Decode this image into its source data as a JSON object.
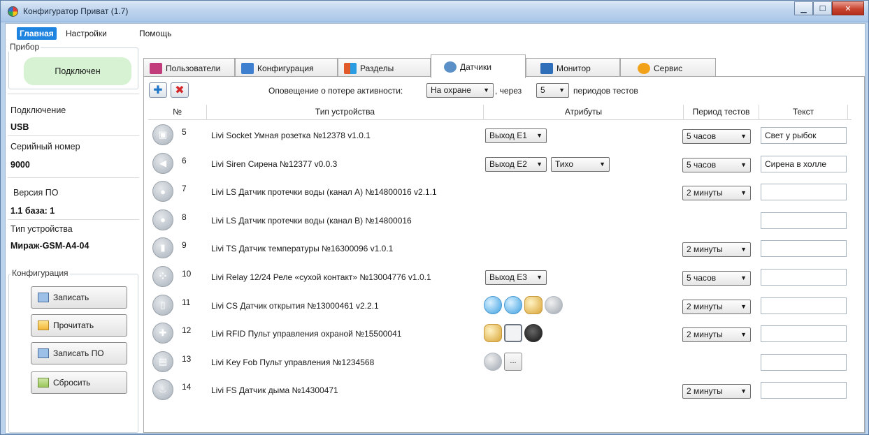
{
  "window": {
    "title": "Конфигуратор Приват (1.7)",
    "min": "▁",
    "max": "☐",
    "close": "✕"
  },
  "menu": {
    "items": [
      "Главная",
      "Настройки",
      "Помощь"
    ]
  },
  "left": {
    "device_group": "Прибор",
    "status": "Подключен",
    "connection_label": "Подключение",
    "connection_value": "USB",
    "serial_label": "Серийный номер",
    "serial_value": "9000",
    "fw_label": "Версия ПО",
    "fw_value": "1.1 база: 1",
    "type_label": "Тип устройства",
    "type_value": "Мираж-GSM-A4-04",
    "config_group": "Конфигурация",
    "buttons": [
      "Записать",
      "Прочитать",
      "Записать ПО",
      "Сбросить"
    ]
  },
  "tabs": [
    {
      "label": "Пользователи",
      "icon": "users-icon",
      "color": "#c23b7a"
    },
    {
      "label": "Конфигурация",
      "icon": "tools-icon",
      "color": "#3f7fcf"
    },
    {
      "label": "Разделы",
      "icon": "sections-icon",
      "color": "#e25a2a"
    },
    {
      "label": "Датчики",
      "icon": "sensors-icon",
      "color": "#5a8fc8"
    },
    {
      "label": "Монитор",
      "icon": "monitor-icon",
      "color": "#2f6fba"
    },
    {
      "label": "Сервис",
      "icon": "service-icon",
      "color": "#f2a21a"
    }
  ],
  "toolbar": {
    "add": "✚",
    "delete": "✖",
    "notify_label": "Оповещение о потере активности:",
    "notify_value": "На охране",
    "through_label": ", через",
    "periods_value": "5",
    "periods_label": "периодов тестов"
  },
  "columns": [
    "№",
    "Тип устройства",
    "Атрибуты",
    "Период тестов",
    "Текст"
  ],
  "rows": [
    {
      "num": "5",
      "type": "Livi Socket Умная розетка №12378 v1.0.1",
      "icon_glyph": "▣",
      "output": "Выход E1",
      "mode": "",
      "period": "5 часов",
      "text": "Свет у рыбок",
      "has_text": true
    },
    {
      "num": "6",
      "type": "Livi Siren Сирена №12377 v0.0.3",
      "icon_glyph": "◀",
      "output": "Выход E2",
      "mode": "Тихо",
      "period": "5 часов",
      "text": "Сирена в холле",
      "has_text": true
    },
    {
      "num": "7",
      "type": "Livi LS Датчик протечки воды (канал А) №14800016 v2.1.1",
      "icon_glyph": "●",
      "output": "",
      "mode": "",
      "period": "2 минуты",
      "text": "",
      "has_text": true
    },
    {
      "num": "8",
      "type": "Livi LS Датчик протечки воды (канал В) №14800016",
      "icon_glyph": "●",
      "output": "",
      "mode": "",
      "period": "",
      "text": "",
      "has_text": true
    },
    {
      "num": "9",
      "type": "Livi TS Датчик температуры №16300096 v1.0.1",
      "icon_glyph": "▮",
      "output": "",
      "mode": "",
      "period": "2 минуты",
      "text": "",
      "has_text": true
    },
    {
      "num": "10",
      "type": "Livi Relay 12/24 Реле «сухой контакт» №13004776 v1.0.1",
      "icon_glyph": "⁘",
      "output": "Выход E3",
      "mode": "",
      "period": "5 часов",
      "text": "",
      "has_text": true
    },
    {
      "num": "11",
      "type": "Livi CS Датчик открытия №13000461 v2.2.1",
      "icon_glyph": "▯",
      "output": "",
      "mode": "",
      "period": "2 минуты",
      "text": "",
      "has_text": true
    },
    {
      "num": "12",
      "type": "Livi RFID Пульт управления охраной №15500041",
      "icon_glyph": "✚",
      "output": "",
      "mode": "",
      "period": "2 минуты",
      "text": "",
      "has_text": true
    },
    {
      "num": "13",
      "type": "Livi Key Fob Пульт управления №1234568",
      "icon_glyph": "▤",
      "output": "",
      "mode": "",
      "period": "",
      "text": "",
      "has_text": true
    },
    {
      "num": "14",
      "type": "Livi FS Датчик дыма №14300471",
      "icon_glyph": "♨",
      "output": "",
      "mode": "",
      "period": "2 минуты",
      "text": "",
      "has_text": true
    }
  ],
  "key_fob_more": "..."
}
